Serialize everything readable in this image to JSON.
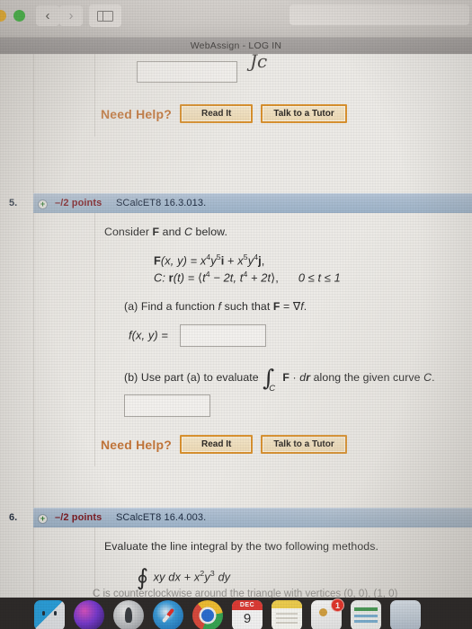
{
  "browser": {
    "tab_title": "WebAssign - LOG IN",
    "back_glyph": "‹",
    "forward_glyph": "›",
    "address_value": "",
    "address_placeholder": ""
  },
  "annotation": {
    "handwriting": "Jc"
  },
  "partial_question_top": {
    "answer_value": "",
    "need_help_label": "Need Help?",
    "read_it_label": "Read It",
    "tutor_label": "Talk to a Tutor"
  },
  "question5": {
    "number": "5.",
    "plus_glyph": "+",
    "points": "–/2 points",
    "code": "SCalcET8 16.3.013.",
    "prompt": "Consider F and C below.",
    "prompt_parts": {
      "lead": "Consider ",
      "bf_F": "F",
      "mid": " and ",
      "it_C": "C",
      "tail": " below."
    },
    "math_F": "F(x, y) = x4y5i + x5y4j,",
    "math_F_parts": {
      "name": "F",
      "args": "(x, y) = ",
      "t1_base": "x",
      "t1_exp": "4",
      "t1_base2": "y",
      "t1_exp2": "5",
      "t1_unit": "i",
      "plus": " + ",
      "t2_base": "x",
      "t2_exp": "5",
      "t2_base2": "y",
      "t2_exp2": "4",
      "t2_unit": "j",
      "comma": ","
    },
    "math_C": "C: r(t) = ⟨t4 − 2t, t4 + 2t⟩,   0 ≤ t ≤ 1",
    "math_C_parts": {
      "label": "C: ",
      "r": "r",
      "of_t": "(t) = ",
      "open": "⟨",
      "x1_base": "t",
      "x1_exp": "4",
      "x1_rest": " − 2t, ",
      "x2_base": "t",
      "x2_exp": "4",
      "x2_rest": " + 2t",
      "close": "⟩,",
      "domain": "0 ≤ t ≤ 1"
    },
    "part_a": {
      "text": "(a) Find a function f such that F = ∇f.",
      "parts": {
        "lead": "(a) Find a function ",
        "it_f": "f",
        "mid": " such that ",
        "bf_F": "F",
        "eq": " = ",
        "nabla": "∇",
        "it_f2": "f",
        "tail": "."
      },
      "answer_label": "f(x, y) =",
      "answer_value": ""
    },
    "part_b": {
      "text": "(b) Use part (a) to evaluate ∫C F · dr along the given curve C.",
      "parts": {
        "lead": "(b) Use part (a) to evaluate ",
        "integral": "∫",
        "limit": "C",
        "bf_F": "F",
        "dot": " · ",
        "dr_d": "d",
        "dr_r": "r",
        "mid": " along the given curve ",
        "it_C": "C",
        "tail": "."
      },
      "answer_value": ""
    },
    "need_help_label": "Need Help?",
    "read_it_label": "Read It",
    "tutor_label": "Talk to a Tutor"
  },
  "question6": {
    "number": "6.",
    "plus_glyph": "+",
    "points": "–/2 points",
    "code": "SCalcET8 16.4.003.",
    "prompt": "Evaluate the line integral by the two following methods.",
    "math_integral": "∮ xy dx + x2y3 dy",
    "math_integral_parts": {
      "contour": "∮",
      "t1": " xy dx + ",
      "t2_base": "x",
      "t2_exp": "2",
      "t3_base": "y",
      "t3_exp": "3",
      "tail": " dy"
    },
    "cutoff_text": "C is counterclockwise around the triangle with vertices (0, 0), (1, 0)"
  },
  "dock": {
    "items": [
      {
        "name": "finder",
        "label": "Finder"
      },
      {
        "name": "siri",
        "label": "Siri"
      },
      {
        "name": "launchpad",
        "label": "Launchpad"
      },
      {
        "name": "safari",
        "label": "Safari"
      },
      {
        "name": "chrome",
        "label": "Google Chrome"
      },
      {
        "name": "calendar",
        "label": "Calendar",
        "month": "DEC",
        "day": "9"
      },
      {
        "name": "notes",
        "label": "Notes"
      },
      {
        "name": "contacts",
        "label": "Contacts",
        "badge": "1"
      },
      {
        "name": "preview",
        "label": "Preview"
      },
      {
        "name": "edge",
        "label": "Edge"
      }
    ]
  },
  "colors": {
    "question_header": "#a7bace",
    "points_red": "#7e1c23",
    "code_navy": "#1e2b40",
    "help_orange": "#c3763a",
    "button_border": "#d9912f",
    "page_bg": "#eceae6",
    "dock_bg": "#2e2b2a",
    "badge_red": "#e8352b"
  }
}
